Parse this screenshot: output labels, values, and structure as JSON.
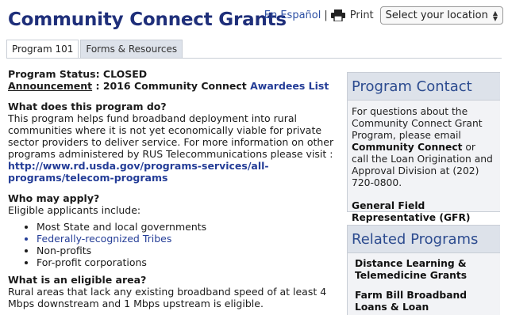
{
  "header": {
    "title": "Community Connect Grants",
    "language_link": "En Español",
    "separator": "|",
    "print_label": "Print",
    "location_select": "Select your location"
  },
  "tabs": [
    {
      "label": "Program 101",
      "active": true
    },
    {
      "label": "Forms & Resources",
      "active": false
    }
  ],
  "main": {
    "status_label": "Program Status",
    "status_value": ": CLOSED",
    "announcement_label": "Announcement",
    "announcement_text": " : 2016 Community Connect ",
    "announcement_link": "Awardees List",
    "q1": "What does this program do?",
    "a1": "This program helps fund broadband deployment into rural communities where it is not yet economically viable for private sector providers to deliver service. For more information on other programs administered by RUS Telecommunications please visit :",
    "a1_link": "http://www.rd.usda.gov/programs-services/all-programs/telecom-programs",
    "q2": "Who may apply?",
    "a2": "Eligible applicants include:",
    "applicants": [
      {
        "text": "Most State and local governments",
        "link": false
      },
      {
        "text": "Federally-recognized Tribes",
        "link": true
      },
      {
        "text": "Non-profits",
        "link": false
      },
      {
        "text": "For-profit corporations",
        "link": false
      }
    ],
    "q3": "What is an eligible area?",
    "a3": "Rural areas that lack any existing broadband speed of at least 4 Mbps downstream and 1 Mbps upstream is eligible."
  },
  "contact": {
    "heading": "Program Contact",
    "text_before": "For questions about the Community Connect Grant Program, please email ",
    "email_label": "Community Connect",
    "text_after": " or call the Loan Origination and Approval Division at (202) 720-0800.",
    "gfr_label": "General Field Representative (GFR) Contact"
  },
  "related": {
    "heading": "Related Programs",
    "items": [
      "Distance Learning & Telemedicine Grants",
      "Farm Bill Broadband Loans & Loan Guarantees"
    ]
  },
  "colors": {
    "title": "#1f2f7a",
    "link": "#243d97",
    "panel_head": "#dde2ea",
    "panel_body": "#f2f3f6"
  }
}
